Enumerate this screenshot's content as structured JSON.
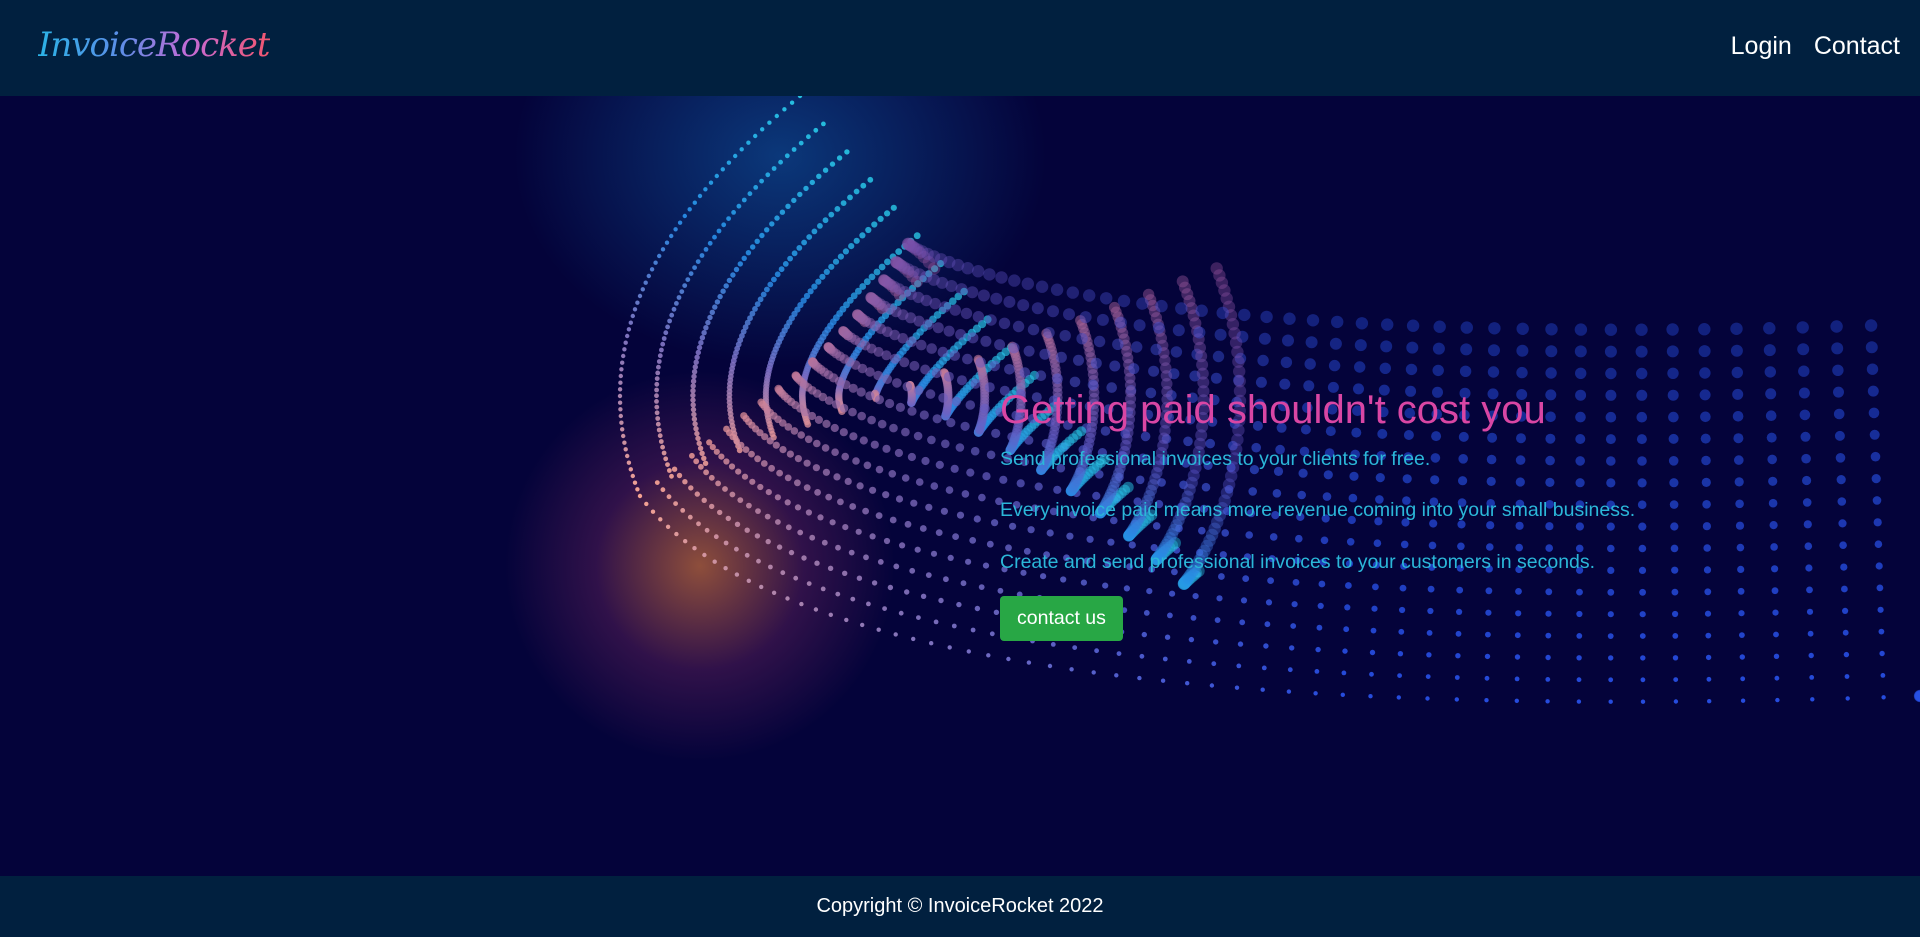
{
  "brand": {
    "name": "InvoiceRocket"
  },
  "nav": {
    "items": [
      {
        "label": "Login"
      },
      {
        "label": "Contact"
      }
    ]
  },
  "hero": {
    "title": "Getting paid shouldn't cost you",
    "lines": [
      "Send professional invoices to your clients for free.",
      "Every invoice paid means more revenue coming into your small business.",
      "Create and send professional invoices to your customers in seconds."
    ],
    "cta_label": "contact us"
  },
  "footer": {
    "copyright": "Copyright © InvoiceRocket 2022"
  },
  "colors": {
    "nav_background": "#01203f",
    "hero_background": "#04033a",
    "title": "#d946a4",
    "body_text": "#2bb7d9",
    "cta": "#28a745"
  }
}
